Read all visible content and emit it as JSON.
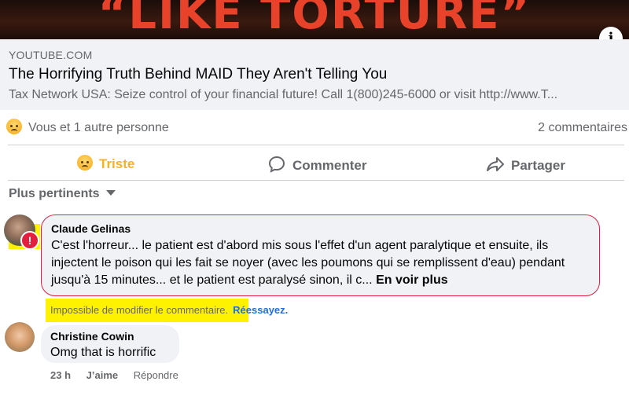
{
  "thumbnail": {
    "text": "“LIKE TORTURE”",
    "info_icon": "info-icon"
  },
  "link_preview": {
    "domain": "YOUTUBE.COM",
    "title": "The Horrifying Truth Behind MAID They Aren't Telling You",
    "description": "Tax Network USA: Seize control of your financial future! Call 1(800)245-6000 or visit http://www.T..."
  },
  "reactions": {
    "summary": "Vous et 1 autre personne",
    "comments_count": "2 commentaires",
    "icon": "sad-emoji-icon"
  },
  "actions": {
    "react": "Triste",
    "comment": "Commenter",
    "share": "Partager"
  },
  "sort": {
    "label": "Plus pertinents"
  },
  "comments": [
    {
      "author": "Claude Gelinas",
      "text": "C'est l'horreur... le patient est d'abord mis sous l'effet d'un agent paralytique et ensuite, ils injectent le poison qui les fait se noyer (avec les poumons qui se remplissent d'eau) pendant jusqu'à 15 minutes... et le patient est paralysé sinon, il c...",
      "see_more": "En voir plus",
      "error_message": "Impossible de modifier le commentaire.",
      "retry": "Réessayez."
    },
    {
      "author": "Christine Cowin",
      "text": "Omg that is horrific",
      "time": "23 h",
      "like": "J’aime",
      "reply": "Répondre"
    }
  ],
  "colors": {
    "highlight": "#fff200",
    "error": "#e41e3f",
    "link": "#216fdb",
    "sad": "#f7b125"
  }
}
